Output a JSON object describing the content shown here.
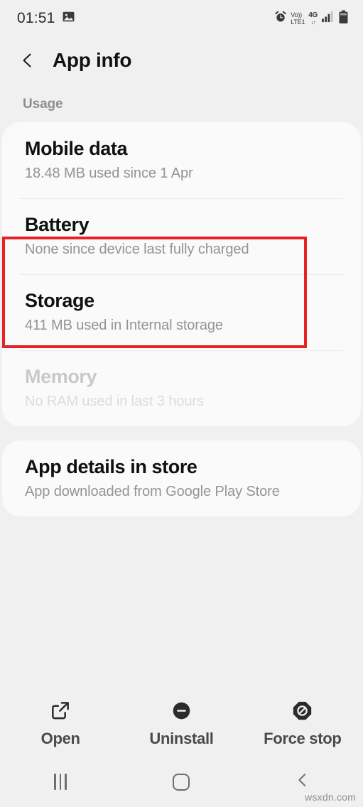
{
  "status_bar": {
    "clock": "01:51",
    "left_icons": [
      "image-icon"
    ],
    "right_icons": [
      "alarm-icon",
      "volte-icon",
      "4g-icon",
      "signal-icon",
      "battery-icon"
    ],
    "volte_top": "Vo))",
    "volte_bottom": "LTE1",
    "network_type": "4G",
    "network_arrows": "↓↑"
  },
  "header": {
    "title": "App info",
    "back_icon": "back-chevron-icon"
  },
  "usage_section": {
    "label": "Usage",
    "rows": [
      {
        "title": "Mobile data",
        "subtitle": "18.48 MB used since 1 Apr",
        "disabled": false,
        "highlighted": false
      },
      {
        "title": "Battery",
        "subtitle": "None since device last fully charged",
        "disabled": false,
        "highlighted": true
      },
      {
        "title": "Storage",
        "subtitle": "411 MB used in Internal storage",
        "disabled": false,
        "highlighted": false
      },
      {
        "title": "Memory",
        "subtitle": "No RAM used in last 3 hours",
        "disabled": true,
        "highlighted": false
      }
    ]
  },
  "store_section": {
    "rows": [
      {
        "title": "App details in store",
        "subtitle": "App downloaded from Google Play Store"
      }
    ]
  },
  "action_bar": {
    "buttons": [
      {
        "label": "Open",
        "icon": "external-link-icon"
      },
      {
        "label": "Uninstall",
        "icon": "minus-circle-icon"
      },
      {
        "label": "Force stop",
        "icon": "prohibition-octagon-icon"
      }
    ]
  },
  "nav_bar": {
    "buttons": [
      {
        "name": "recents",
        "icon": "recents-icon"
      },
      {
        "name": "home",
        "icon": "home-square-icon"
      },
      {
        "name": "back",
        "icon": "back-chevron-icon"
      }
    ]
  },
  "watermark": "wsxdn.com",
  "colors": {
    "highlight": "#e82127",
    "card_background": "#fafafa",
    "page_background": "#f0f0f0",
    "title_text": "#111111",
    "subtitle_text": "#949494",
    "disabled_text": "#c9c9c9"
  }
}
